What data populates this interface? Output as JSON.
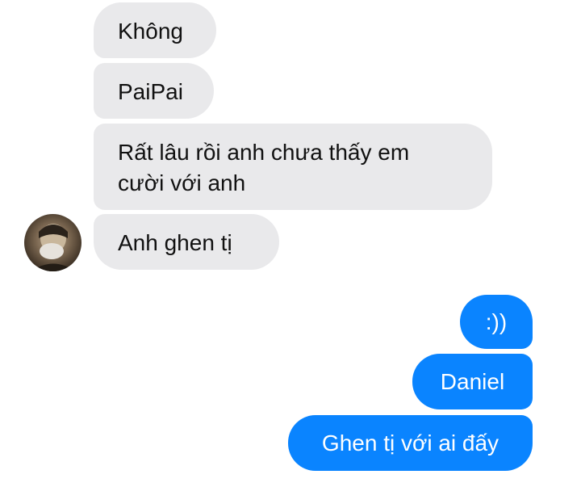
{
  "chat": {
    "incoming": [
      {
        "text": "Không"
      },
      {
        "text": "PaiPai"
      },
      {
        "line1": "Rất lâu rồi anh chưa thấy em",
        "line2": "cười với anh"
      },
      {
        "text": "Anh ghen tị"
      }
    ],
    "outgoing": [
      {
        "text": ":))"
      },
      {
        "text": "Daniel"
      },
      {
        "text": "Ghen tị với ai đấy"
      }
    ]
  },
  "colors": {
    "incoming_bubble": "#e9e9eb",
    "outgoing_bubble": "#0a84ff"
  },
  "icons": {
    "avatar": "contact-avatar-photo"
  }
}
